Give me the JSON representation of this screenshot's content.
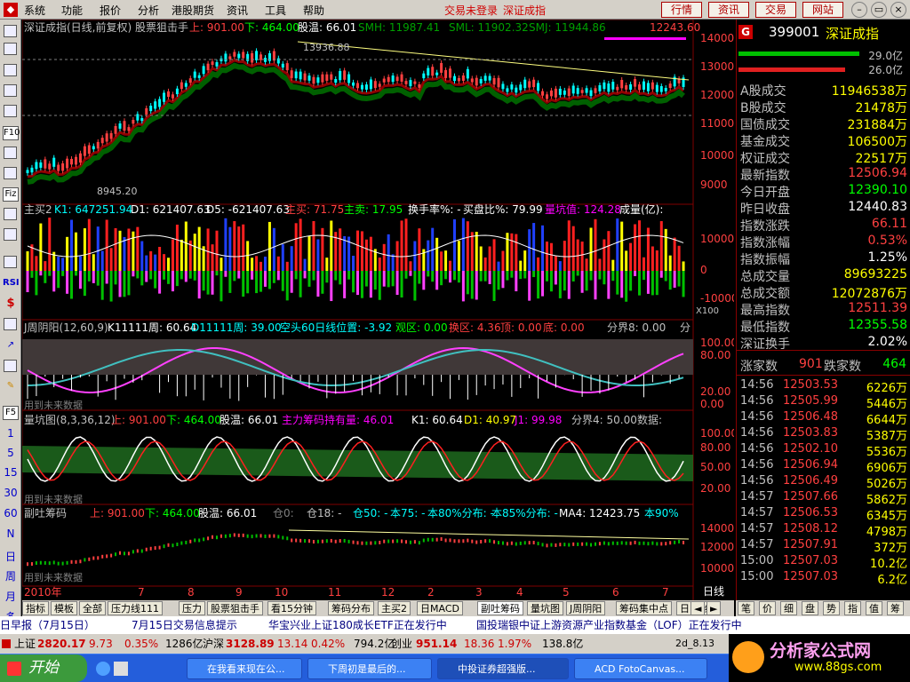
{
  "menu": {
    "items": [
      "系统",
      "功能",
      "报价",
      "分析",
      "港股期货",
      "资讯",
      "工具",
      "帮助"
    ],
    "login_status": "交易未登录",
    "index_name": "深证成指",
    "buttons": [
      "行情",
      "资讯",
      "交易",
      "网站"
    ]
  },
  "lefttb": {
    "labels": [
      "F10",
      "Fiz",
      "RSI",
      "F5",
      "1",
      "5",
      "15",
      "30",
      "60",
      "N",
      "日",
      "周",
      "月",
      "多",
      "季"
    ]
  },
  "panel1": {
    "title": "深证成指(日线,前复权) 股票狙击手",
    "up": "上: 901.00",
    "down": "下: 464.00",
    "temp": "股温: 66.01",
    "smh": "SMH: 11987.41",
    "sml": "SML: 11902.32",
    "smj": "SMJ: 11944.86",
    "high_label": "13936.88",
    "low_label": "8945.20",
    "price_badge": "12243.60",
    "y_ticks": [
      "14000",
      "13000",
      "12000",
      "11000",
      "10000",
      "9000"
    ]
  },
  "panel2": {
    "title": "主买2",
    "k1": "K1: 647251.94",
    "d1": "D1: 621407.63",
    "d5": "D5: -621407.63",
    "zm": "主买: 71.75",
    "zmi": "主卖: 17.95",
    "hs": "换手率%: -",
    "mp": "买盘比%: 79.99",
    "lk": "量坑值: 124.28",
    "unit": "成量(亿):",
    "y_ticks": [
      "10000",
      "0",
      "-10000"
    ],
    "x100": "X100"
  },
  "panel3": {
    "title": "J周阴阳(12,60,9)",
    "k": "K11111周: 60.64",
    "d": "D11111周: 39.00",
    "kt": "空头60日线位置: -3.92",
    "gq": "观区: 0.00",
    "hq": "换区: 4.36",
    "top": "顶: 0.00",
    "bot": "底: 0.00",
    "fj": "分界8: 0.00",
    "fen": "分",
    "y_ticks": [
      "100.00",
      "80.00",
      "20.00",
      "0.00"
    ],
    "watermark": "用到未来数据"
  },
  "panel4": {
    "title": "量坑图(8,3,36,12)",
    "up": "上: 901.00",
    "down": "下: 464.00",
    "temp": "股温: 66.01",
    "zl": "主力筹码持有量: 46.01",
    "k1": "K1: 60.64",
    "d1": "D1: 40.97",
    "j1": "J1: 99.98",
    "fj": "分界4: 50.00",
    "fen": "数据:",
    "y_ticks": [
      "100.00",
      "80.00",
      "50.00",
      "20.00"
    ],
    "watermark": "用到未来数据"
  },
  "panel5": {
    "title": "副吐筹码",
    "up": "上: 901.00",
    "down": "下: 464.00",
    "temp": "股温: 66.01",
    "l0": "仓0:",
    "l18": "仓18: -",
    "l50": "仓50: -",
    "b75": "本75: -",
    "b80": "本80%分布: -",
    "b85": "本85%分布: -",
    "ma4": "MA4: 12423.75",
    "b90": "本90%",
    "y_ticks": [
      "14000",
      "12000",
      "10000"
    ],
    "watermark": "用到未来数据"
  },
  "xaxis": {
    "year": "2010年",
    "months": [
      "7",
      "8",
      "9",
      "10",
      "11",
      "12",
      "2",
      "3",
      "4",
      "5",
      "6",
      "7"
    ],
    "mode": "日线"
  },
  "rightpanel": {
    "flag": "G",
    "code": "399001",
    "name": "深证成指",
    "bar1": "29.0亿",
    "bar2": "26.0亿",
    "rows": [
      {
        "label": "A股成交",
        "value": "11946538万",
        "color": "#ffff00"
      },
      {
        "label": "B股成交",
        "value": "21478万",
        "color": "#ffff00"
      },
      {
        "label": "国债成交",
        "value": "231884万",
        "color": "#ffff00"
      },
      {
        "label": "基金成交",
        "value": "106500万",
        "color": "#ffff00"
      },
      {
        "label": "权证成交",
        "value": "22517万",
        "color": "#ffff00"
      },
      {
        "label": "最新指数",
        "value": "12506.94",
        "color": "#ff4040"
      },
      {
        "label": "今日开盘",
        "value": "12390.10",
        "color": "#00ff00"
      },
      {
        "label": "昨日收盘",
        "value": "12440.83",
        "color": "#ffffff"
      },
      {
        "label": "指数涨跌",
        "value": "66.11",
        "color": "#ff4040"
      },
      {
        "label": "指数涨幅",
        "value": "0.53%",
        "color": "#ff4040"
      },
      {
        "label": "指数振幅",
        "value": "1.25%",
        "color": "#ffffff"
      },
      {
        "label": "总成交量",
        "value": "89693225",
        "color": "#ffff00"
      },
      {
        "label": "总成交额",
        "value": "12072876万",
        "color": "#ffff00"
      },
      {
        "label": "最高指数",
        "value": "12511.39",
        "color": "#ff4040"
      },
      {
        "label": "最低指数",
        "value": "12355.58",
        "color": "#00ff00"
      },
      {
        "label": "深证换手",
        "value": "2.02%",
        "color": "#ffffff"
      }
    ],
    "zhang": "涨家数",
    "zhang_v": "901",
    "die": "跌家数",
    "die_v": "464",
    "trades": [
      {
        "t": "14:56",
        "p": "12503.53",
        "q": "6226万"
      },
      {
        "t": "14:56",
        "p": "12505.99",
        "q": "5446万"
      },
      {
        "t": "14:56",
        "p": "12506.48",
        "q": "6644万"
      },
      {
        "t": "14:56",
        "p": "12503.83",
        "q": "5387万"
      },
      {
        "t": "14:56",
        "p": "12502.10",
        "q": "5536万"
      },
      {
        "t": "14:56",
        "p": "12506.94",
        "q": "6906万"
      },
      {
        "t": "14:56",
        "p": "12506.49",
        "q": "5026万"
      },
      {
        "t": "14:57",
        "p": "12507.66",
        "q": "5862万"
      },
      {
        "t": "14:57",
        "p": "12506.53",
        "q": "6345万"
      },
      {
        "t": "14:57",
        "p": "12508.12",
        "q": "4798万"
      },
      {
        "t": "14:57",
        "p": "12507.91",
        "q": "372万"
      },
      {
        "t": "15:00",
        "p": "12507.03",
        "q": "10.2亿"
      },
      {
        "t": "15:00",
        "p": "12507.03",
        "q": "6.2亿"
      }
    ]
  },
  "tabs": [
    "指标",
    "模板",
    "全部",
    "压力线111",
    "压力",
    "股票狙击手",
    "看15分钟",
    "筹码分布",
    "主买2",
    "日MACD",
    "副吐筹码",
    "量坑图",
    "J周阴阳",
    "筹码集中点",
    "日MK线"
  ],
  "active_tab": "副吐筹码",
  "rtabs": [
    "笔",
    "价",
    "细",
    "盘",
    "势",
    "指",
    "值",
    "筹"
  ],
  "news": {
    "items": [
      "日早报（7月15日）",
      "7月15日交易信息提示",
      "华宝兴业上证180成长ETF正在发行中",
      "国投瑞银中证上游资源产业指数基金（LOF）正在发行中"
    ]
  },
  "status": {
    "sh_label": "上证",
    "sh_value": "2820.17",
    "sh_chg": "9.73",
    "sh_pct": "0.35%",
    "sh_amt": "1286亿",
    "sz_label": "沪深",
    "sz_value": "3128.89",
    "sz_chg": "13.14",
    "sz_pct": "0.42%",
    "sz_amt": "794.2亿",
    "cy_label": "创业",
    "cy_value": "951.14",
    "cy_chg": "18.36",
    "cy_pct": "1.97%",
    "cy_amt": "138.8亿",
    "date": "2d_8.13"
  },
  "taskbar": {
    "start": "开始",
    "items": [
      "在我看来现在公...",
      "下周初是最后的...",
      "中投证券超强版...",
      "ACD FotoCanvas..."
    ]
  },
  "logo": {
    "title": "分析家公式网",
    "url": "www.88gs.com"
  }
}
